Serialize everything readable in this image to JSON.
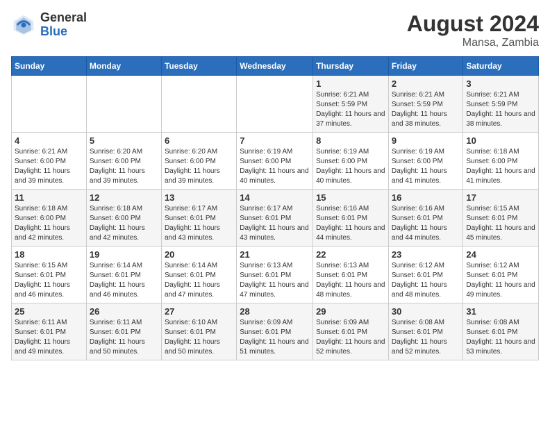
{
  "header": {
    "logo": {
      "general": "General",
      "blue": "Blue"
    },
    "title": "August 2024",
    "location": "Mansa, Zambia"
  },
  "days_of_week": [
    "Sunday",
    "Monday",
    "Tuesday",
    "Wednesday",
    "Thursday",
    "Friday",
    "Saturday"
  ],
  "weeks": [
    [
      {
        "day": "",
        "info": ""
      },
      {
        "day": "",
        "info": ""
      },
      {
        "day": "",
        "info": ""
      },
      {
        "day": "",
        "info": ""
      },
      {
        "day": "1",
        "info": "Sunrise: 6:21 AM\nSunset: 5:59 PM\nDaylight: 11 hours and 37 minutes."
      },
      {
        "day": "2",
        "info": "Sunrise: 6:21 AM\nSunset: 5:59 PM\nDaylight: 11 hours and 38 minutes."
      },
      {
        "day": "3",
        "info": "Sunrise: 6:21 AM\nSunset: 5:59 PM\nDaylight: 11 hours and 38 minutes."
      }
    ],
    [
      {
        "day": "4",
        "info": "Sunrise: 6:21 AM\nSunset: 6:00 PM\nDaylight: 11 hours and 39 minutes."
      },
      {
        "day": "5",
        "info": "Sunrise: 6:20 AM\nSunset: 6:00 PM\nDaylight: 11 hours and 39 minutes."
      },
      {
        "day": "6",
        "info": "Sunrise: 6:20 AM\nSunset: 6:00 PM\nDaylight: 11 hours and 39 minutes."
      },
      {
        "day": "7",
        "info": "Sunrise: 6:19 AM\nSunset: 6:00 PM\nDaylight: 11 hours and 40 minutes."
      },
      {
        "day": "8",
        "info": "Sunrise: 6:19 AM\nSunset: 6:00 PM\nDaylight: 11 hours and 40 minutes."
      },
      {
        "day": "9",
        "info": "Sunrise: 6:19 AM\nSunset: 6:00 PM\nDaylight: 11 hours and 41 minutes."
      },
      {
        "day": "10",
        "info": "Sunrise: 6:18 AM\nSunset: 6:00 PM\nDaylight: 11 hours and 41 minutes."
      }
    ],
    [
      {
        "day": "11",
        "info": "Sunrise: 6:18 AM\nSunset: 6:00 PM\nDaylight: 11 hours and 42 minutes."
      },
      {
        "day": "12",
        "info": "Sunrise: 6:18 AM\nSunset: 6:00 PM\nDaylight: 11 hours and 42 minutes."
      },
      {
        "day": "13",
        "info": "Sunrise: 6:17 AM\nSunset: 6:01 PM\nDaylight: 11 hours and 43 minutes."
      },
      {
        "day": "14",
        "info": "Sunrise: 6:17 AM\nSunset: 6:01 PM\nDaylight: 11 hours and 43 minutes."
      },
      {
        "day": "15",
        "info": "Sunrise: 6:16 AM\nSunset: 6:01 PM\nDaylight: 11 hours and 44 minutes."
      },
      {
        "day": "16",
        "info": "Sunrise: 6:16 AM\nSunset: 6:01 PM\nDaylight: 11 hours and 44 minutes."
      },
      {
        "day": "17",
        "info": "Sunrise: 6:15 AM\nSunset: 6:01 PM\nDaylight: 11 hours and 45 minutes."
      }
    ],
    [
      {
        "day": "18",
        "info": "Sunrise: 6:15 AM\nSunset: 6:01 PM\nDaylight: 11 hours and 46 minutes."
      },
      {
        "day": "19",
        "info": "Sunrise: 6:14 AM\nSunset: 6:01 PM\nDaylight: 11 hours and 46 minutes."
      },
      {
        "day": "20",
        "info": "Sunrise: 6:14 AM\nSunset: 6:01 PM\nDaylight: 11 hours and 47 minutes."
      },
      {
        "day": "21",
        "info": "Sunrise: 6:13 AM\nSunset: 6:01 PM\nDaylight: 11 hours and 47 minutes."
      },
      {
        "day": "22",
        "info": "Sunrise: 6:13 AM\nSunset: 6:01 PM\nDaylight: 11 hours and 48 minutes."
      },
      {
        "day": "23",
        "info": "Sunrise: 6:12 AM\nSunset: 6:01 PM\nDaylight: 11 hours and 48 minutes."
      },
      {
        "day": "24",
        "info": "Sunrise: 6:12 AM\nSunset: 6:01 PM\nDaylight: 11 hours and 49 minutes."
      }
    ],
    [
      {
        "day": "25",
        "info": "Sunrise: 6:11 AM\nSunset: 6:01 PM\nDaylight: 11 hours and 49 minutes."
      },
      {
        "day": "26",
        "info": "Sunrise: 6:11 AM\nSunset: 6:01 PM\nDaylight: 11 hours and 50 minutes."
      },
      {
        "day": "27",
        "info": "Sunrise: 6:10 AM\nSunset: 6:01 PM\nDaylight: 11 hours and 50 minutes."
      },
      {
        "day": "28",
        "info": "Sunrise: 6:09 AM\nSunset: 6:01 PM\nDaylight: 11 hours and 51 minutes."
      },
      {
        "day": "29",
        "info": "Sunrise: 6:09 AM\nSunset: 6:01 PM\nDaylight: 11 hours and 52 minutes."
      },
      {
        "day": "30",
        "info": "Sunrise: 6:08 AM\nSunset: 6:01 PM\nDaylight: 11 hours and 52 minutes."
      },
      {
        "day": "31",
        "info": "Sunrise: 6:08 AM\nSunset: 6:01 PM\nDaylight: 11 hours and 53 minutes."
      }
    ]
  ]
}
